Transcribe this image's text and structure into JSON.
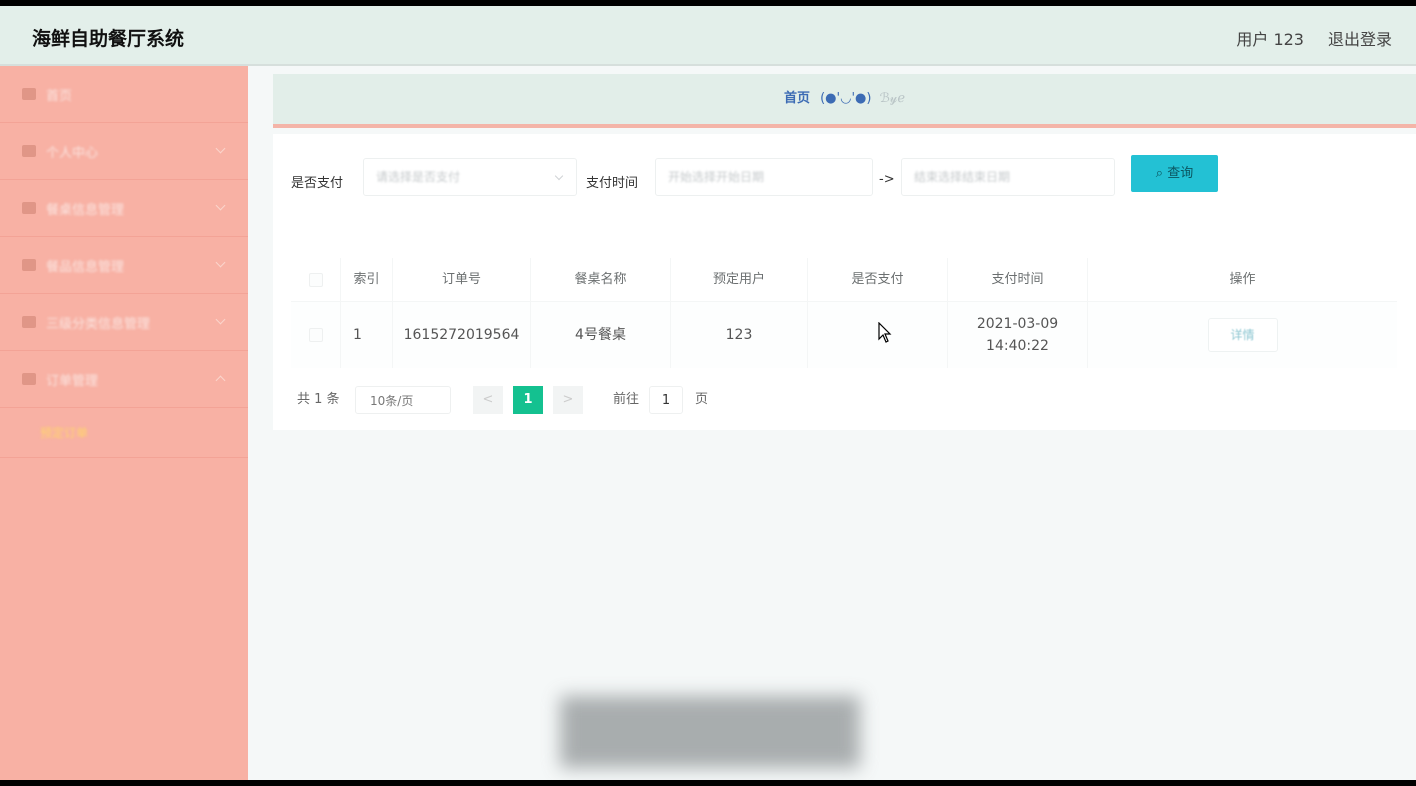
{
  "header": {
    "title": "海鲜自助餐厅系统",
    "user_label": "用户 123",
    "logout_label": "退出登录"
  },
  "sidebar": {
    "items": [
      {
        "label": "首页",
        "icon": "home-icon",
        "expandable": false
      },
      {
        "label": "个人中心",
        "icon": "user-icon",
        "expandable": true
      },
      {
        "label": "餐桌信息管理",
        "icon": "table-icon",
        "expandable": true
      },
      {
        "label": "餐品信息管理",
        "icon": "menu-icon",
        "expandable": true
      },
      {
        "label": "三级分类信息管理",
        "icon": "category-icon",
        "expandable": true
      },
      {
        "label": "订单管理",
        "icon": "order-icon",
        "expandable": true,
        "expanded": true
      }
    ],
    "sub_items": [
      {
        "label": "预定订单"
      }
    ],
    "colors": {
      "background": "#f8b1a4",
      "active_text": "#ffd66b"
    }
  },
  "breadcrumb": {
    "home": "首页",
    "face": "(●'◡'●)",
    "tail": "ℬ𝓎ℯ"
  },
  "search": {
    "paid_label": "是否支付",
    "paid_placeholder": "请选择是否支付",
    "time_label": "支付时间",
    "start_placeholder": "开始选择开始日期",
    "separator": "->",
    "end_placeholder": "结束选择结束日期",
    "button_label": "查询",
    "button_color": "#23c1d4"
  },
  "table": {
    "headers": [
      "",
      "索引",
      "订单号",
      "餐桌名称",
      "预定用户",
      "是否支付",
      "支付时间",
      "操作"
    ],
    "rows": [
      {
        "index": "1",
        "order_no": "1615272019564",
        "table_name": "4号餐桌",
        "user": "123",
        "paid": "",
        "pay_time": "2021-03-09 14:40:22",
        "action": "详情"
      }
    ]
  },
  "pagination": {
    "total": "共 1 条",
    "page_size": "10条/页",
    "prev": "<",
    "current": "1",
    "next": ">",
    "goto_label": "前往",
    "goto_value": "1",
    "page_unit": "页",
    "active_color": "#14c190"
  }
}
